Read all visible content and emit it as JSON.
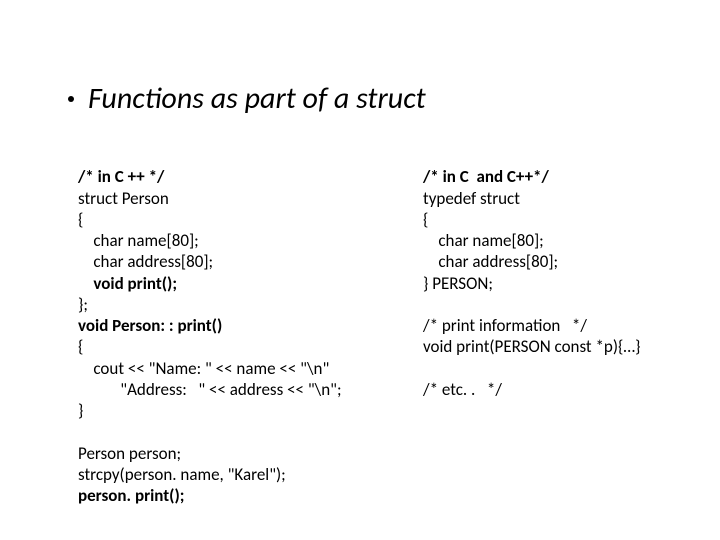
{
  "title": "Functions as part of a struct",
  "left": {
    "l01": "/* in C ++ */",
    "l02": "struct Person",
    "l03": "{",
    "l04": "    char name[80];",
    "l05": "    char address[80];",
    "l06": "    void print();",
    "l07": "};",
    "l08": "void Person: : print()",
    "l09": "{",
    "l10": "    cout << \"Name: \" << name << \"\\n\"",
    "l11": "           \"Address:   \" << address << \"\\n\";",
    "l12": "}",
    "l13": "",
    "l14": "Person person;",
    "l15": "strcpy(person. name, \"Karel\");",
    "l16": "person. print();"
  },
  "right": {
    "r01": "/* in C  and C++*/",
    "r02": "typedef struct",
    "r03": "{",
    "r04": "    char name[80];",
    "r05": "    char address[80];",
    "r06": "} PERSON;",
    "r07": "",
    "r08": "/* print information   */",
    "r09": "void print(PERSON const *p){…}",
    "r10": "",
    "r11": "/* etc. .   */"
  }
}
